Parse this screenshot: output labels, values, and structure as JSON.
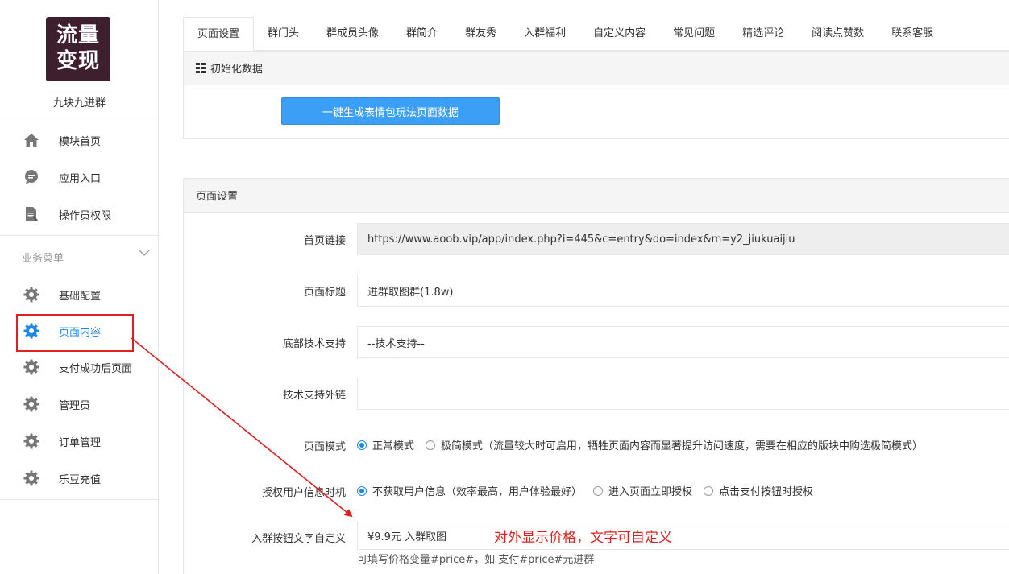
{
  "sidebar": {
    "logo_line1": "流量",
    "logo_line2": "变现",
    "brand_name": "九块九进群",
    "top_items": [
      {
        "label": "模块首页",
        "icon": "home-icon"
      },
      {
        "label": "应用入口",
        "icon": "chat-icon"
      },
      {
        "label": "操作员权限",
        "icon": "document-edit-icon"
      }
    ],
    "group_title": "业务菜单",
    "group_items": [
      {
        "label": "基础配置",
        "icon": "gear-icon"
      },
      {
        "label": "页面内容",
        "icon": "gear-icon",
        "active": true
      },
      {
        "label": "支付成功后页面",
        "icon": "gear-icon"
      },
      {
        "label": "管理员",
        "icon": "gear-icon"
      },
      {
        "label": "订单管理",
        "icon": "gear-icon"
      },
      {
        "label": "乐豆充值",
        "icon": "gear-icon"
      }
    ]
  },
  "tabs": [
    "页面设置",
    "群门头",
    "群成员头像",
    "群简介",
    "群友秀",
    "入群福利",
    "自定义内容",
    "常见问题",
    "精选评论",
    "阅读点赞数",
    "联系客服"
  ],
  "init_panel": {
    "title": "初始化数据",
    "button_label": "一键生成表情包玩法页面数据"
  },
  "settings_panel": {
    "title": "页面设置",
    "home_link": {
      "label": "首页链接",
      "value": "https://www.aoob.vip/app/index.php?i=445&c=entry&do=index&m=y2_jiukuaijiu"
    },
    "page_title": {
      "label": "页面标题",
      "value": "进群取图群(1.8w)"
    },
    "footer_support": {
      "label": "底部技术支持",
      "value": "--技术支持--"
    },
    "support_link": {
      "label": "技术支持外链",
      "value": ""
    },
    "page_mode": {
      "label": "页面模式",
      "options": [
        "正常模式",
        "极简模式（流量较大时可启用，牺牲页面内容而显著提升访问速度，需要在相应的版块中购选极简模式）"
      ],
      "selected": 0
    },
    "auth_timing": {
      "label": "授权用户信息时机",
      "options": [
        "不获取用户信息（效率最高，用户体验最好）",
        "进入页面立即授权",
        "点击支付按钮时授权"
      ],
      "selected": 0
    },
    "join_button_text": {
      "label": "入群按钮文字自定义",
      "value": "¥9.9元 入群取图"
    },
    "hint": "可填写价格变量#price#，如 支付#price#元进群"
  },
  "annotation": "对外显示价格，文字可自定义",
  "colors": {
    "accent": "#1e88e5",
    "button": "#3b9ff5",
    "annotation": "#e02020",
    "logo_bg": "#3d1f2e"
  }
}
